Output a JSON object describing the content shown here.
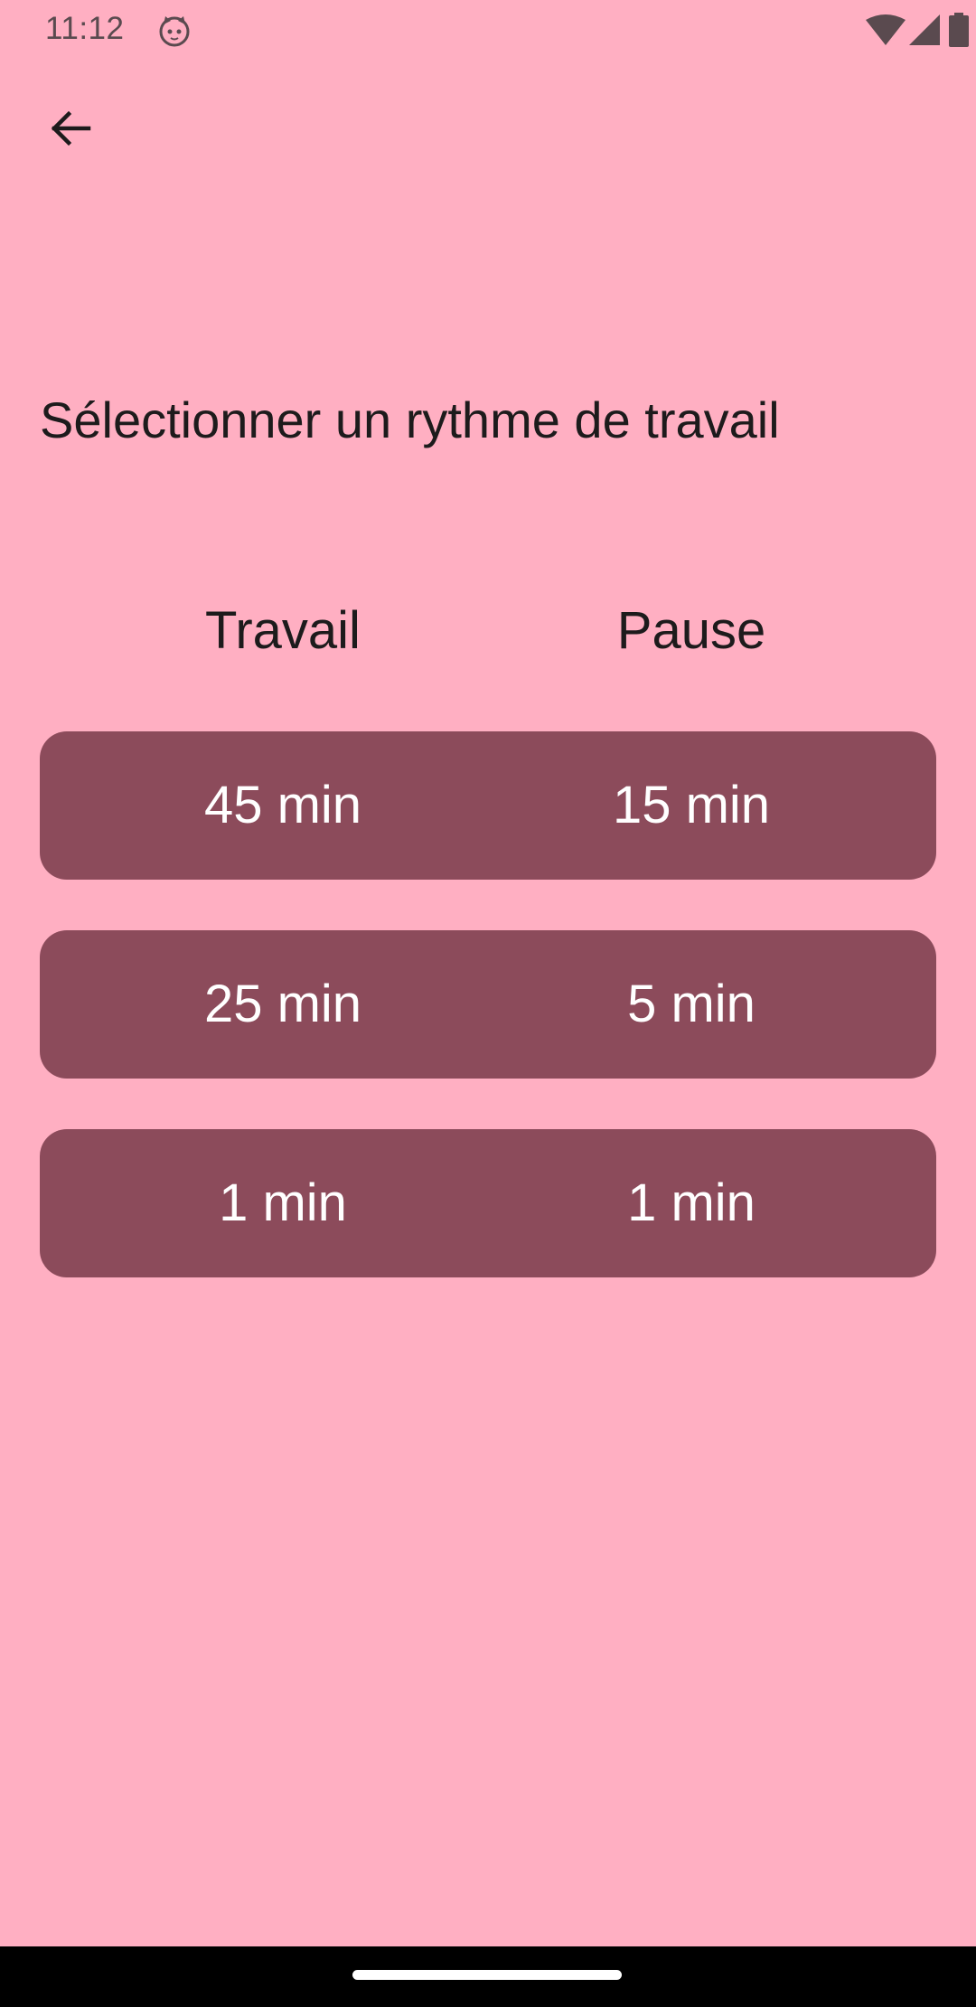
{
  "status_bar": {
    "time": "11:12",
    "icons": [
      "cat-icon",
      "wifi-icon",
      "signal-icon",
      "battery-icon"
    ]
  },
  "header": {
    "back_icon": "arrow-back-icon"
  },
  "title": "Sélectionner un rythme de travail",
  "columns": {
    "work": "Travail",
    "pause": "Pause"
  },
  "rhythms": [
    {
      "work": "45 min",
      "pause": "15 min"
    },
    {
      "work": "25 min",
      "pause": "5 min"
    },
    {
      "work": "1 min",
      "pause": "1 min"
    }
  ],
  "colors": {
    "background": "#FFAFC2",
    "option_background": "#8C4B5B",
    "option_text": "#FFFFFF",
    "text": "#1D1B1C"
  }
}
